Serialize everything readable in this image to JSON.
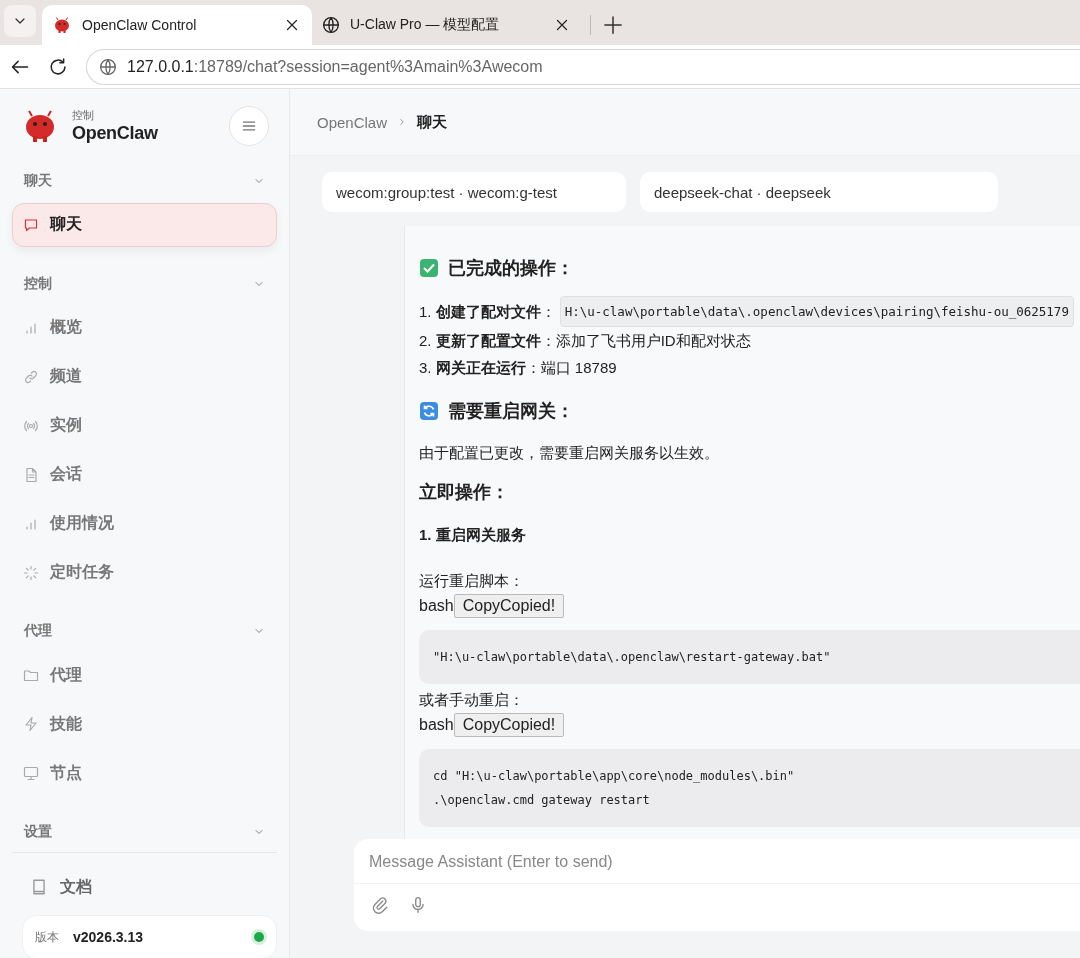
{
  "browser": {
    "tabs": [
      {
        "title": "OpenClaw Control",
        "selected": true
      },
      {
        "title": "U-Claw Pro — 模型配置",
        "selected": false
      }
    ],
    "address": {
      "host": "127.0.0.1",
      "path": ":18789/chat?session=agent%3Amain%3Awecom"
    }
  },
  "sidebar": {
    "brand": {
      "subtitle": "控制",
      "title": "OpenClaw"
    },
    "sections": [
      {
        "title": "聊天",
        "items": [
          {
            "label": "聊天",
            "selected": true
          }
        ]
      },
      {
        "title": "控制",
        "items": [
          {
            "label": "概览",
            "selected": false
          },
          {
            "label": "频道",
            "selected": false
          },
          {
            "label": "实例",
            "selected": false
          },
          {
            "label": "会话",
            "selected": false
          },
          {
            "label": "使用情况",
            "selected": false
          },
          {
            "label": "定时任务",
            "selected": false
          }
        ]
      },
      {
        "title": "代理",
        "items": [
          {
            "label": "代理",
            "selected": false
          },
          {
            "label": "技能",
            "selected": false
          },
          {
            "label": "节点",
            "selected": false
          }
        ]
      },
      {
        "title": "设置"
      }
    ],
    "docs": "文档",
    "version": {
      "label": "版本",
      "value": "v2026.3.13",
      "online": true
    }
  },
  "breadcrumb": [
    "OpenClaw",
    "聊天"
  ],
  "chips": [
    "wecom:group:test · wecom:g-test",
    "deepseek-chat · deepseek"
  ],
  "message": [
    {
      "kind": "heading-check",
      "text": "已完成的操作："
    },
    {
      "kind": "list",
      "items": [
        {
          "text": "1. **创建了配对文件**：",
          "code": "H:\\u-claw\\portable\\data\\.openclaw\\devices\\pairing\\feishu-ou_0625179"
        },
        {
          "text": "2. **更新了配置文件**：添加了飞书用户ID和配对状态"
        },
        {
          "text": "3. **网关正在运行**：端口 18789"
        }
      ]
    },
    {
      "kind": "heading-refresh",
      "text": "需要重启网关："
    },
    {
      "kind": "paragraph",
      "text": "由于配置已更改，需要重启网关服务以生效。"
    },
    {
      "kind": "heading",
      "text": "立即操作："
    },
    {
      "kind": "subheading",
      "text": "1. 重启网关服务"
    },
    {
      "kind": "paragraph",
      "text": "运行重启脚本："
    },
    {
      "kind": "bash",
      "label": "bash",
      "button": "CopyCopied!"
    },
    {
      "kind": "code",
      "lines": [
        "\"H:\\u-claw\\portable\\data\\.openclaw\\restart-gateway.bat\""
      ]
    },
    {
      "kind": "paragraph",
      "text": "或者手动重启："
    },
    {
      "kind": "bash",
      "label": "bash",
      "button": "CopyCopied!"
    },
    {
      "kind": "code",
      "lines": [
        "cd \"H:\\u-claw\\portable\\app\\core\\node_modules\\.bin\"",
        ".\\openclaw.cmd gateway restart"
      ]
    }
  ],
  "composer": {
    "placeholder": "Message Assistant (Enter to send)"
  }
}
